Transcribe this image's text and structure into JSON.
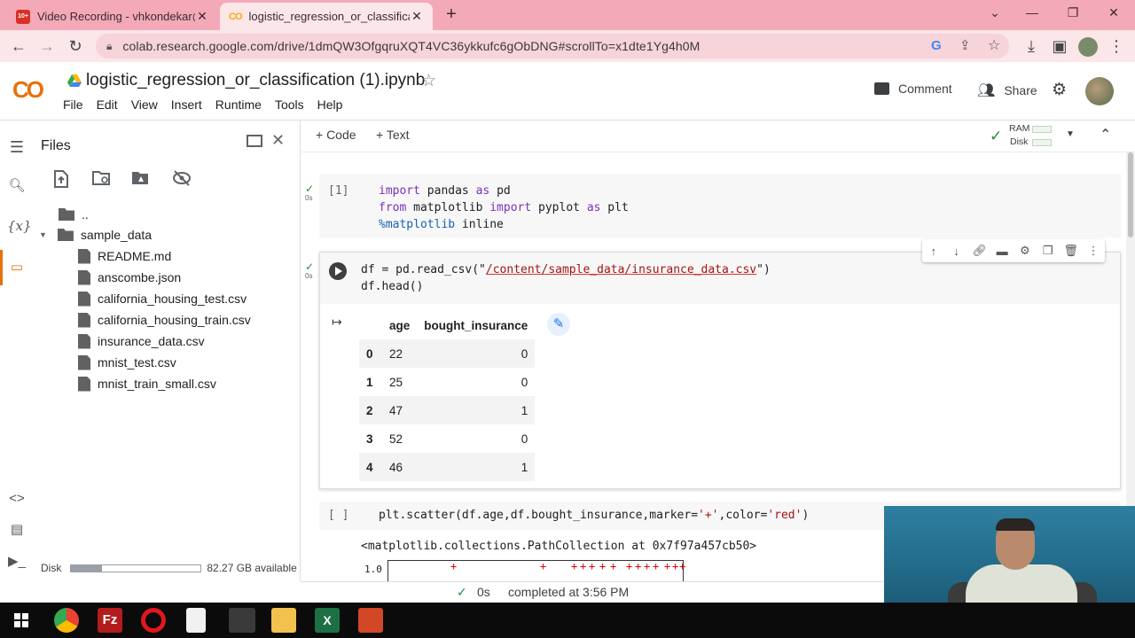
{
  "browser": {
    "tabs": [
      {
        "title": "Video Recording - vhkondekar@",
        "close": "✕",
        "favicon": "video-recording-icon"
      },
      {
        "title": "logistic_regression_or_classificati",
        "close": "✕",
        "favicon": "colab-icon"
      }
    ],
    "new_tab": "+",
    "url": "colab.research.google.com/drive/1dmQW3OfgqruXQT4VC36ykkufc6gObDNG#scrollTo=x1dte1Yg4h0M"
  },
  "colab": {
    "logo": "CO",
    "notebook_title": "logistic_regression_or_classification (1).ipynb",
    "menu": [
      "File",
      "Edit",
      "View",
      "Insert",
      "Runtime",
      "Tools",
      "Help"
    ],
    "comment_label": "Comment",
    "share_label": "Share",
    "add_code": "+ Code",
    "add_text": "+ Text",
    "ram_label": "RAM",
    "disk_label": "Disk"
  },
  "files_panel": {
    "title": "Files",
    "parent": "..",
    "folder": "sample_data",
    "files": [
      "README.md",
      "anscombe.json",
      "california_housing_test.csv",
      "california_housing_train.csv",
      "insurance_data.csv",
      "mnist_test.csv",
      "mnist_train_small.csv"
    ],
    "disk_label": "Disk",
    "disk_available": "82.27 GB available",
    "disk_used_fraction": 0.24
  },
  "cells": [
    {
      "exec_count": "[1]",
      "run_time": "0s",
      "lines": [
        {
          "kw1": "import",
          "t1": " pandas ",
          "kw2": "as",
          "t2": " pd"
        },
        {
          "kw1": "from",
          "t1": " matplotlib ",
          "kw2": "import",
          "t2": " pyplot ",
          "kw3": "as",
          "t3": " plt"
        },
        {
          "magic": "%matplotlib",
          "t1": " inline"
        }
      ]
    },
    {
      "run_time": "0s",
      "line1_prefix": "df = pd.read_csv(\"",
      "line1_string": "/content/sample_data/insurance_data.csv",
      "line1_suffix": "\")",
      "line2": "df.head()",
      "dataframe": {
        "columns": [
          "age",
          "bought_insurance"
        ],
        "rows": [
          {
            "index": "0",
            "age": "22",
            "bought_insurance": "0"
          },
          {
            "index": "1",
            "age": "25",
            "bought_insurance": "0"
          },
          {
            "index": "2",
            "age": "47",
            "bought_insurance": "1"
          },
          {
            "index": "3",
            "age": "52",
            "bought_insurance": "0"
          },
          {
            "index": "4",
            "age": "46",
            "bought_insurance": "1"
          }
        ]
      }
    },
    {
      "exec_count": "[ ]",
      "code": "plt.scatter(df.age,df.bought_insurance,marker='+',color='red')",
      "code_prefix": "plt.scatter(df.age,df.bought_insurance,marker=",
      "code_s1": "'+'",
      "code_mid": ",color=",
      "code_s2": "'red'",
      "code_suffix": ")",
      "output_text": "<matplotlib.collections.PathCollection at 0x7f97a457cb50>",
      "plot_ytick": "1.0",
      "plot_marker": "+"
    }
  ],
  "status": {
    "duration": "0s",
    "completed": "completed at 3:56 PM"
  },
  "colors": {
    "tab_bar": "#f3a9b8",
    "address_bar": "#fbe6ea",
    "colab_orange": "#f9ab00",
    "check_green": "#1e8e3e",
    "keyword_purple": "#7b2fbe",
    "string_red": "#a31515"
  }
}
